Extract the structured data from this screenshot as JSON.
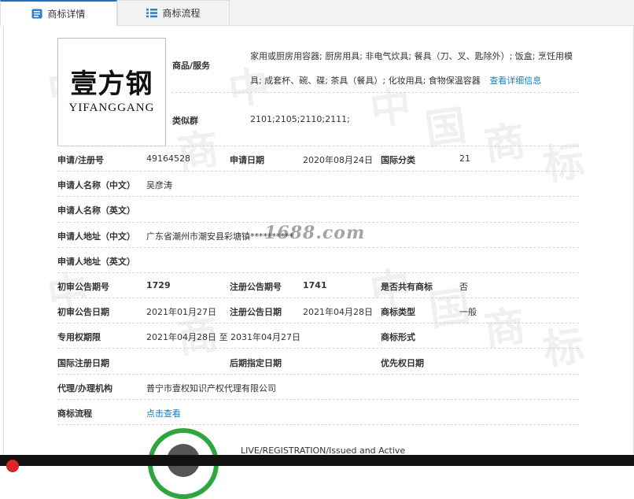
{
  "tabs": [
    {
      "label": "商标详情"
    },
    {
      "label": "商标流程"
    }
  ],
  "trademark": {
    "name_cn": "壹方钢",
    "name_en": "YIFANGGANG"
  },
  "goods": {
    "label": "商品/服务",
    "text": "家用或厨房用容器; 厨房用具; 非电气炊具; 餐具（刀、叉、匙除外）; 饭盒; 烹饪用模具; 成套杯、碗、碟; 茶具（餐具）; 化妆用具; 食物保温容器",
    "detail_link": "查看详细信息"
  },
  "similar_group": {
    "label": "类似群",
    "value": "2101;2105;2110;2111;"
  },
  "fields": {
    "reg_no": {
      "label": "申请/注册号",
      "value": "49164528"
    },
    "apply_date": {
      "label": "申请日期",
      "value": "2020年08月24日"
    },
    "intl_class": {
      "label": "国际分类",
      "value": "21"
    },
    "applicant_cn": {
      "label": "申请人名称（中文）",
      "value": "吴彦涛"
    },
    "applicant_en": {
      "label": "申请人名称（英文）",
      "value": ""
    },
    "address_cn": {
      "label": "申请人地址（中文）",
      "value": "广东省潮州市潮安县彩塘镇**********"
    },
    "address_en": {
      "label": "申请人地址（英文）",
      "value": ""
    },
    "prelim_issue": {
      "label": "初审公告期号",
      "value": "1729"
    },
    "reg_issue": {
      "label": "注册公告期号",
      "value": "1741"
    },
    "shared": {
      "label": "是否共有商标",
      "value": "否"
    },
    "prelim_date": {
      "label": "初审公告日期",
      "value": "2021年01月27日"
    },
    "reg_date": {
      "label": "注册公告日期",
      "value": "2021年04月28日"
    },
    "tm_type": {
      "label": "商标类型",
      "value": "一般"
    },
    "exclusive": {
      "label": "专用权期限",
      "value": "2021年04月28日 至 2031年04月27日"
    },
    "tm_form": {
      "label": "商标形式",
      "value": ""
    },
    "intl_reg_date": {
      "label": "国际注册日期",
      "value": ""
    },
    "later_date": {
      "label": "后期指定日期",
      "value": ""
    },
    "priority_date": {
      "label": "优先权日期",
      "value": ""
    },
    "agency": {
      "label": "代理/办理机构",
      "value": "普宁市壹权知识产权代理有限公司"
    },
    "process": {
      "label": "商标流程",
      "value": "点击查看"
    }
  },
  "status": {
    "text": "LIVE/REGISTRATION/Issued and Active"
  },
  "watermark": {
    "site": "1688.com",
    "chars": [
      "中",
      "国",
      "商",
      "标"
    ]
  },
  "colors": {
    "accent": "#1a6fc7",
    "link": "#1a7fb8",
    "status_green": "#2ea640"
  }
}
